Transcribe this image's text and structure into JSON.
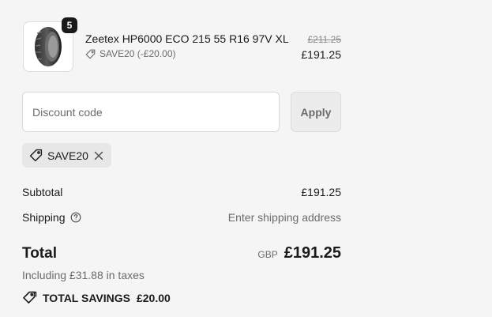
{
  "line_item": {
    "quantity": "5",
    "title": "Zeetex HP6000 ECO 215 55 R16 97V XL",
    "discount_text": "SAVE20 (-£20.00)",
    "price_original": "£211.25",
    "price_discounted": "£191.25",
    "image_icon": "tyre-icon"
  },
  "discount": {
    "placeholder": "Discount code",
    "value": "",
    "apply_label": "Apply"
  },
  "applied_code": {
    "label": "SAVE20",
    "tag_icon": "tag-icon",
    "remove_icon": "close-icon"
  },
  "summary": {
    "subtotal_label": "Subtotal",
    "subtotal_value": "£191.25",
    "shipping_label": "Shipping",
    "shipping_help_icon": "help-circle-icon",
    "shipping_value": "Enter shipping address",
    "total_label": "Total",
    "currency": "GBP",
    "total_value": "£191.25",
    "taxes_text": "Including £31.88 in taxes",
    "savings_icon": "savings-tag-icon",
    "savings_label": "TOTAL SAVINGS",
    "savings_value": "£20.00"
  }
}
